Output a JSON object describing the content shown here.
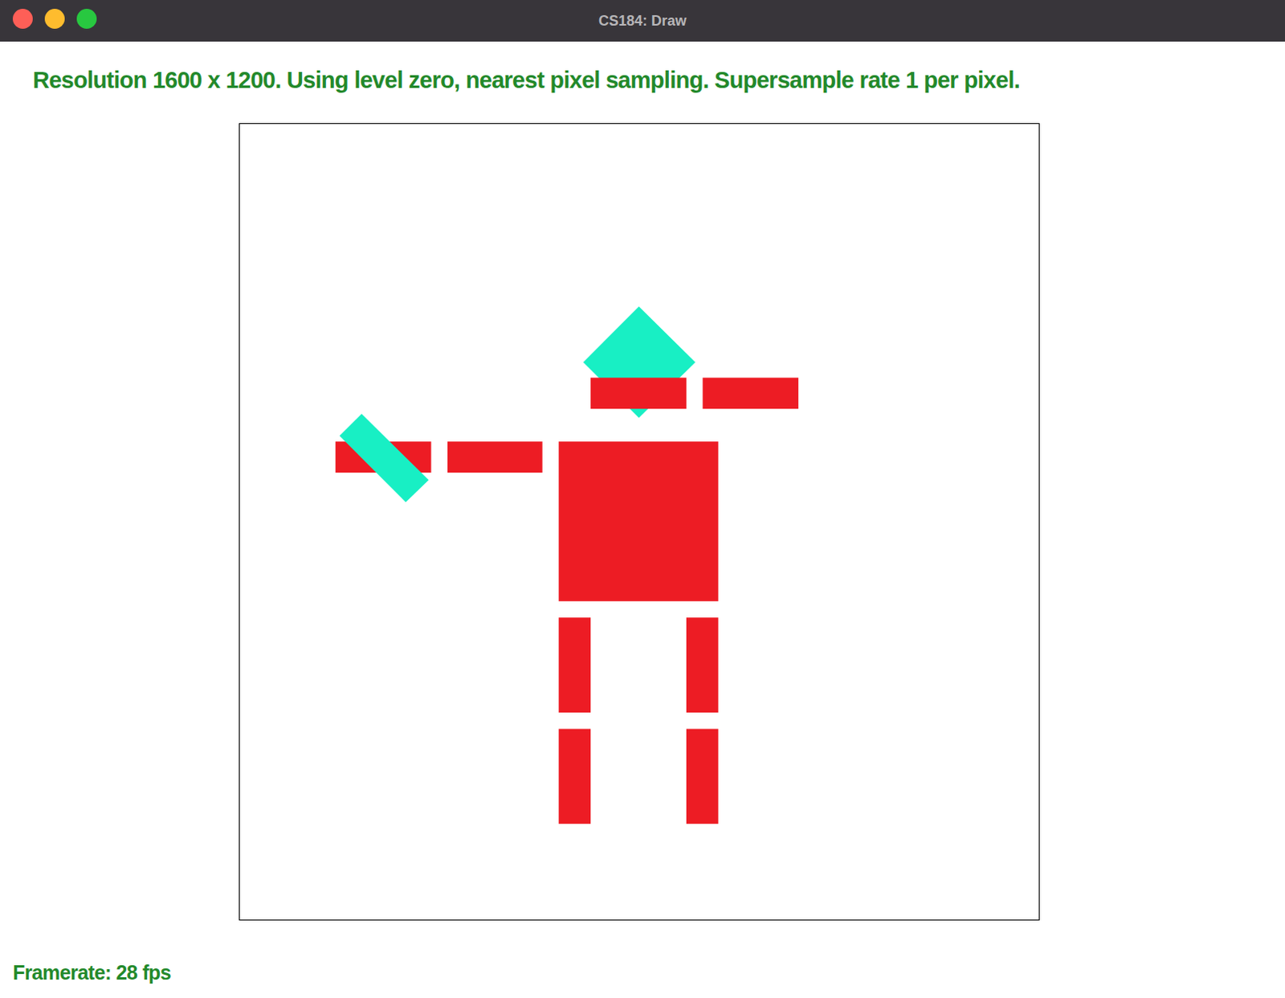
{
  "window": {
    "title": "CS184: Draw"
  },
  "status": "Resolution 1600 x 1200. Using level zero, nearest pixel sampling. Supersample rate 1 per pixel.",
  "figure": {
    "shapes": [
      {
        "name": "torso",
        "kind": "rect",
        "color": "#ed1c24"
      },
      {
        "name": "left-upper-leg",
        "kind": "rect",
        "color": "#ed1c24"
      },
      {
        "name": "left-lower-leg",
        "kind": "rect",
        "color": "#ed1c24"
      },
      {
        "name": "right-upper-leg",
        "kind": "rect",
        "color": "#ed1c24"
      },
      {
        "name": "right-lower-leg",
        "kind": "rect",
        "color": "#ed1c24"
      },
      {
        "name": "left-inner-arm",
        "kind": "rect",
        "color": "#ed1c24"
      },
      {
        "name": "left-outer-arm",
        "kind": "rect",
        "color": "#ed1c24"
      },
      {
        "name": "head",
        "kind": "polygon",
        "color": "#18efc4"
      },
      {
        "name": "right-inner-arm",
        "kind": "rect",
        "color": "#ed1c24"
      },
      {
        "name": "right-outer-arm",
        "kind": "rect",
        "color": "#ed1c24"
      },
      {
        "name": "hand",
        "kind": "polygon",
        "color": "#18efc4"
      }
    ]
  },
  "footer": {
    "framerate": "Framerate: 28 fps"
  }
}
